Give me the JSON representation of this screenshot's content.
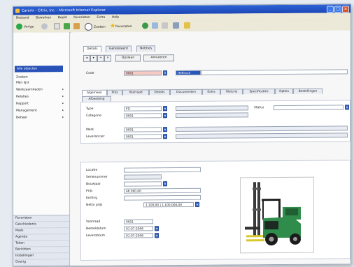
{
  "window": {
    "title": "Carerix - Citrix, Inc. - Microsoft Internet Explorer",
    "controls": [
      "_",
      "□",
      "×"
    ]
  },
  "menubar": [
    "Bestand",
    "Bewerken",
    "Beeld",
    "Favorieten",
    "Extra",
    "Help"
  ],
  "toolbar": {
    "back": "Vorige",
    "search": "Zoeken",
    "favorites": "Favorieten"
  },
  "sidebar": {
    "selected": "Alle objecten",
    "items": [
      {
        "label": "Zoeken"
      },
      {
        "label": "Mijn lijst"
      },
      {
        "label": "Werkzaamheden",
        "arrow": "▸"
      },
      {
        "label": "Relaties",
        "arrow": "▸"
      },
      {
        "label": "Rapport",
        "arrow": "▸"
      },
      {
        "label": "Management",
        "arrow": "▸"
      },
      {
        "label": "Beheer",
        "arrow": "▸"
      }
    ],
    "bottom": [
      "Favorieten",
      "Geschiedenis",
      "Mails",
      "Agenda",
      "Taken",
      "Berichten",
      "Instellingen",
      "Overig"
    ]
  },
  "main": {
    "tabs": [
      "Details",
      "Gerelateerd",
      "Notities"
    ],
    "small_buttons": [
      "◂",
      "▸",
      "+",
      "×"
    ],
    "action_buttons": [
      "Opslaan",
      "Annuleren"
    ],
    "header_label": "Code",
    "header_code": "0001",
    "header_name": "Heftruck",
    "subtabs": [
      "Algemeen",
      "Prijs",
      "Voorraad",
      "Details",
      "Documenten",
      "Extra",
      "Historie",
      "Specificaties",
      "Opties",
      "Bestellingen"
    ],
    "subtabs2": [
      "Afbeelding"
    ],
    "fields1": [
      {
        "label": "Type",
        "value": "FD"
      },
      {
        "label": "Categorie",
        "value": "0001"
      }
    ],
    "field1_right_label": "Status",
    "fields2": [
      {
        "label": "Merk",
        "value": "0001"
      },
      {
        "label": "Leverancier",
        "value": "0001"
      }
    ],
    "fields3": [
      {
        "label": "Locatie",
        "value": ""
      },
      {
        "label": "Serienummer",
        "value": ""
      },
      {
        "label": "Bouwjaar",
        "value": ""
      },
      {
        "label": "Prijs",
        "value": "46.900,00"
      },
      {
        "label": "Korting",
        "value": ""
      },
      {
        "label": "Netto prijs",
        "value": "1.100,00 | 1.100.000,00"
      }
    ],
    "fields4": [
      {
        "label": "Voorraad",
        "value": "0001"
      },
      {
        "label": "Besteldatum",
        "value": "01-07-2006"
      },
      {
        "label": "Leverdatum",
        "value": "01-07-2006"
      }
    ]
  },
  "colors": {
    "titlebar": "#2d63d6",
    "selection": "#2852b8",
    "highlight": "#f6c9c3"
  }
}
